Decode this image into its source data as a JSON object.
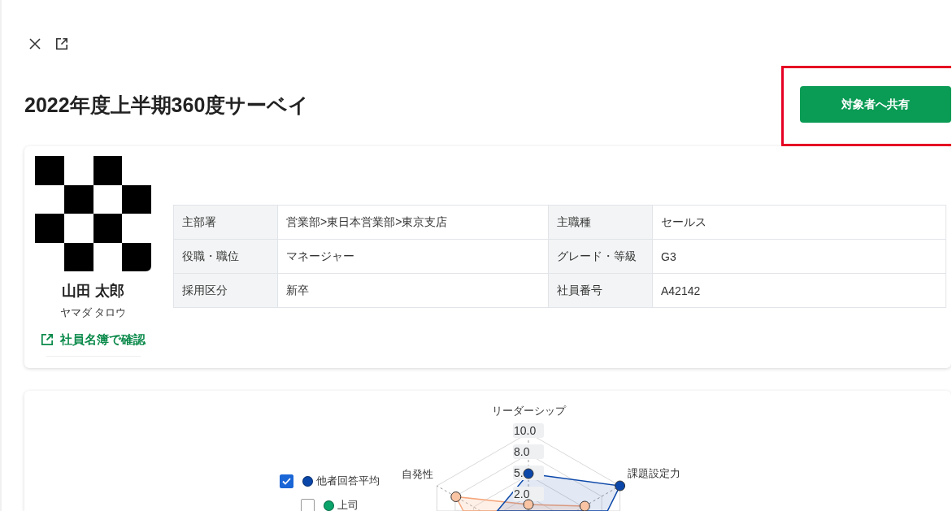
{
  "title": "2022年度上半期360度サーベイ",
  "share_button": {
    "label": "対象者へ共有",
    "highlighted": true
  },
  "profile": {
    "name": "山田 太郎",
    "kana": "ヤマダ タロウ",
    "link": "社員名簿で確認",
    "fields": [
      {
        "label": "主部署",
        "value": "営業部>東日本営業部>東京支店"
      },
      {
        "label": "主職種",
        "value": "セールス"
      },
      {
        "label": "役職・職位",
        "value": "マネージャー"
      },
      {
        "label": "グレード・等級",
        "value": "G3"
      },
      {
        "label": "採用区分",
        "value": "新卒"
      },
      {
        "label": "社員番号",
        "value": "A42142"
      }
    ]
  },
  "chart": {
    "legend": [
      {
        "label": "他者回答平均",
        "checked": true,
        "color": "#0b47a9"
      },
      {
        "label": "上司",
        "checked": false,
        "color": "#0aa36a"
      }
    ],
    "axis_labels": [
      {
        "label": "リーダーシップ",
        "kind": "top"
      },
      {
        "label": "課題設定力",
        "kind": "right"
      },
      {
        "label": "自発性",
        "kind": "left"
      }
    ],
    "ticks": [
      "10.0",
      "8.0",
      "5.",
      "2.0"
    ]
  }
}
